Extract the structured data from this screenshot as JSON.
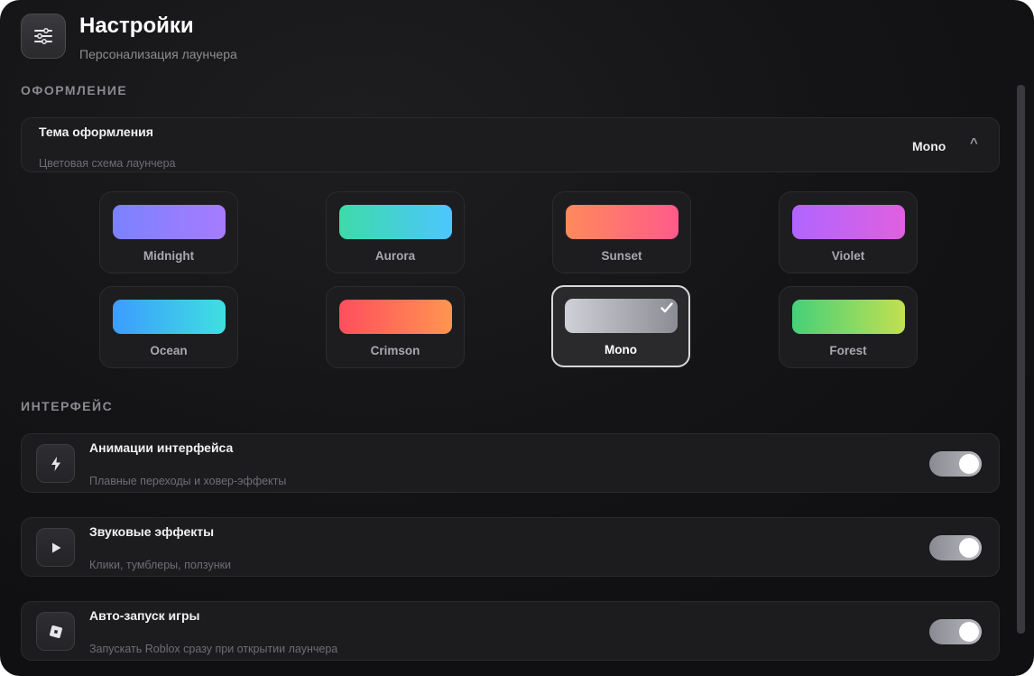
{
  "header": {
    "title": "Настройки",
    "subtitle": "Персонализация лаунчера",
    "icon": "sliders-icon"
  },
  "sections": {
    "appearance_title": "ОФОРМЛЕНИЕ",
    "interface_title": "ИНТЕРФЕЙС"
  },
  "theme_select": {
    "label": "Тема оформления",
    "description": "Цветовая схема лаунчера",
    "value": "Mono",
    "caret": "^"
  },
  "themes": [
    {
      "name": "Midnight",
      "colors": [
        "#7b82ff",
        "#a77bff"
      ]
    },
    {
      "name": "Aurora",
      "colors": [
        "#3ddba8",
        "#4cc6ff"
      ]
    },
    {
      "name": "Sunset",
      "colors": [
        "#ff8a5c",
        "#ff5a8a"
      ]
    },
    {
      "name": "Violet",
      "colors": [
        "#b065ff",
        "#e060e0"
      ]
    },
    {
      "name": "Ocean",
      "colors": [
        "#3c9cff",
        "#3ee0e0"
      ]
    },
    {
      "name": "Crimson",
      "colors": [
        "#ff4e5e",
        "#ff9550"
      ]
    },
    {
      "name": "Mono",
      "colors": [
        "#cfcfd6",
        "#8c8c94"
      ],
      "selected": true
    },
    {
      "name": "Forest",
      "colors": [
        "#45d07a",
        "#c2e050"
      ]
    }
  ],
  "settings": [
    {
      "label": "Анимации интерфейса",
      "description": "Плавные переходы и ховер-эффекты",
      "icon": "bolt-icon",
      "enabled": true
    },
    {
      "label": "Звуковые эффекты",
      "description": "Клики, тумблеры, ползунки",
      "icon": "play-icon",
      "enabled": true
    },
    {
      "label": "Авто-запуск игры",
      "description": "Запускать Roblox сразу при открытии лаунчера",
      "icon": "roblox-icon",
      "enabled": true
    }
  ],
  "colors": {
    "background": "#141416",
    "card": "#1c1c1f",
    "accent": "#d8d8dc"
  }
}
